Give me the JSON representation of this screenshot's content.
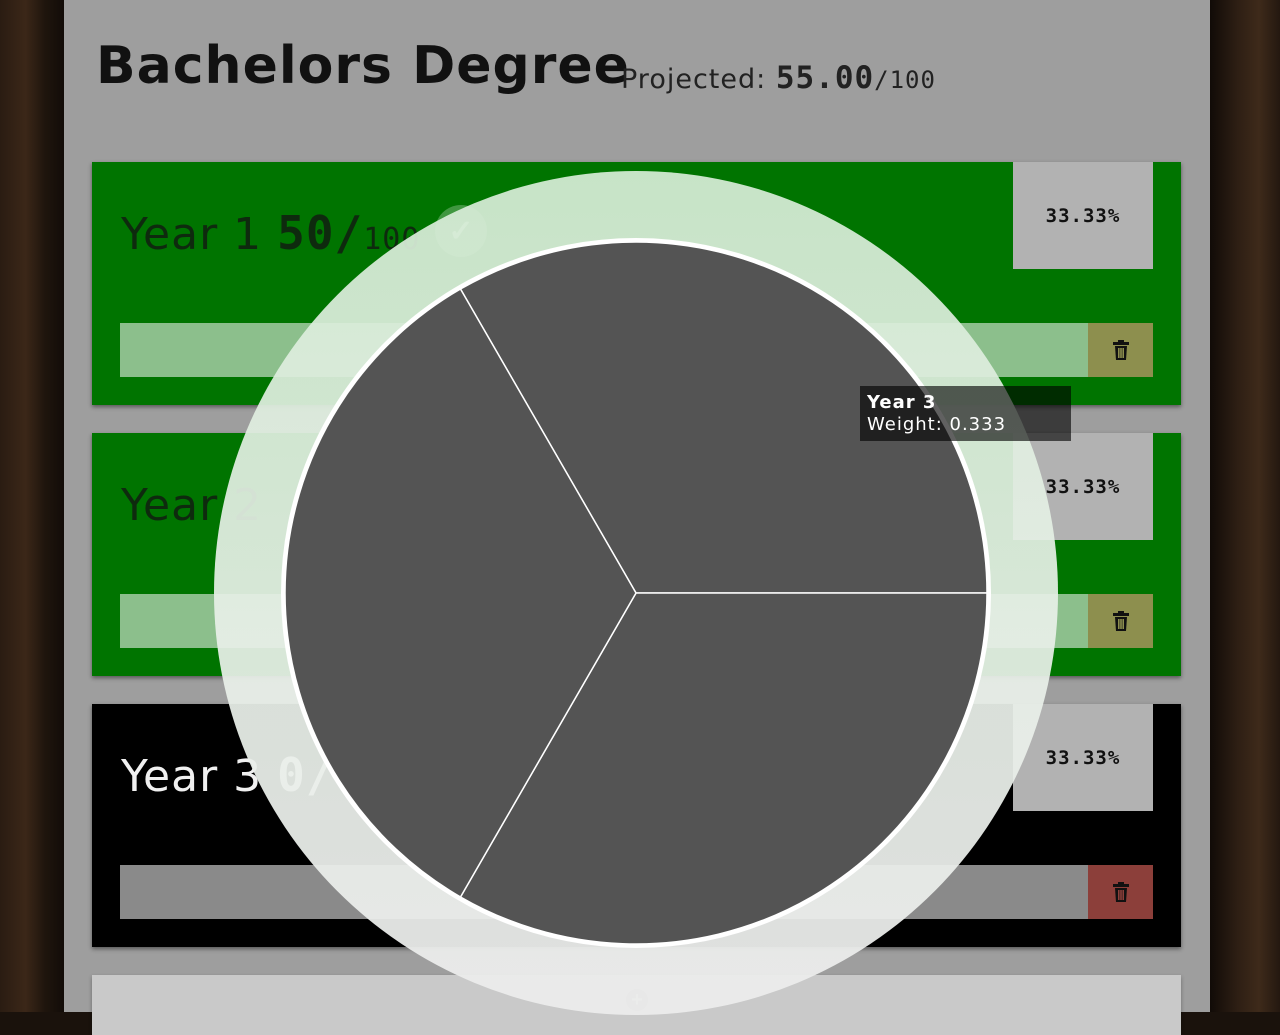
{
  "page": {
    "title": "Bachelors Degree",
    "projected_label": "Projected:",
    "projected_value": "55.00",
    "projected_max": "/100"
  },
  "years": [
    {
      "name": "Year 1",
      "score": "50/",
      "max": "100",
      "weight": "33.33%",
      "state": "passed",
      "bar_color": "#8cbf8c",
      "card_color": "#007400"
    },
    {
      "name": "Year 2",
      "score": "",
      "max": "",
      "weight": "33.33%",
      "state": "passed",
      "bar_color": "#8cbf8c",
      "card_color": "#007400"
    },
    {
      "name": "Year 3",
      "score": "0/",
      "max": "",
      "weight": "33.33%",
      "state": "none",
      "bar_color": "#8a8a8a",
      "card_color": "#000000"
    }
  ],
  "icons": {
    "delete": "trash-icon",
    "check": "check-icon",
    "add": "plus-circle-icon"
  },
  "pie": {
    "tooltip_name": "Year 3",
    "tooltip_weight": "Weight: 0.333"
  },
  "chart_data": {
    "type": "pie",
    "categories": [
      "Year 1",
      "Year 2",
      "Year 3"
    ],
    "values": [
      0.333,
      0.333,
      0.333
    ],
    "colors": [
      "#545454",
      "#545454",
      "#545454"
    ]
  }
}
